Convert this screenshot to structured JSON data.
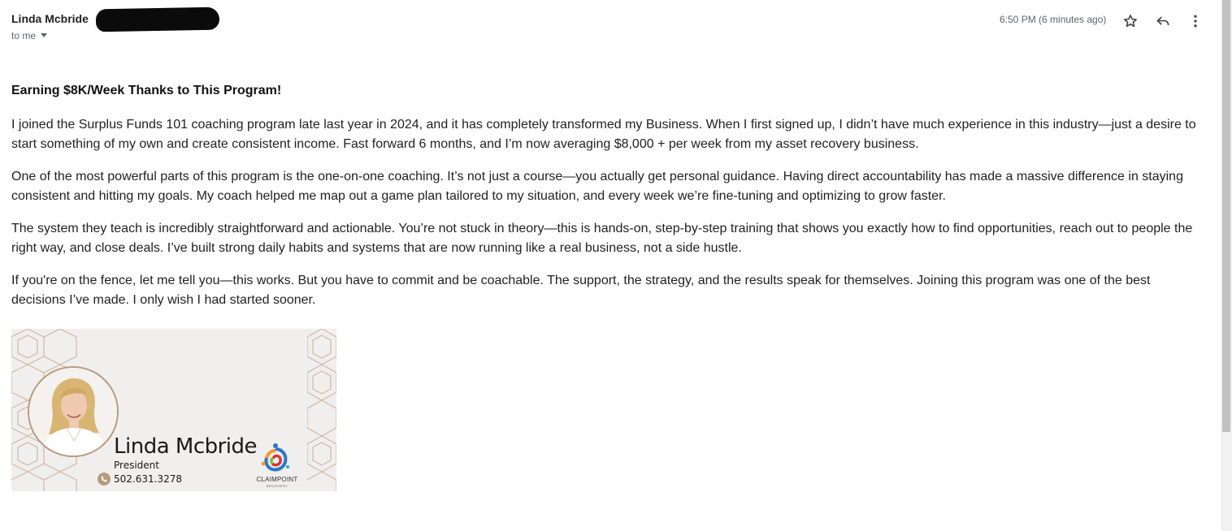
{
  "header": {
    "sender_name": "Linda Mcbride",
    "recipient_label": "to me",
    "timestamp": "6:50 PM (6 minutes ago)",
    "icons": [
      "star-icon",
      "reply-icon",
      "more-vert-icon"
    ]
  },
  "email": {
    "subject": "Earning $8K/Week Thanks to This Program!",
    "paragraphs": [
      "I joined the Surplus Funds 101 coaching program late last year in 2024, and it has completely transformed my Business. When I first signed up, I didn’t have much experience in this industry—just a desire to start something of my own and create consistent income. Fast forward 6 months, and I’m now averaging $8,000 + per week from my asset recovery business.",
      "One of the most powerful parts of this program is the one-on-one coaching. It’s not just a course—you actually get personal guidance. Having direct accountability has made a massive difference in staying consistent and hitting my goals. My coach helped me map out a game plan tailored to my situation, and every week we’re fine-tuning and optimizing to grow faster.",
      "The system they teach is incredibly straightforward and actionable. You’re not stuck in theory—this is hands-on, step-by-step training that shows you exactly how to find opportunities, reach out to people the right way, and close deals. I’ve built strong daily habits and systems that are now running like a real business, not a side hustle.",
      "If you're on the fence, let me tell you—this works. But you have to commit and be coachable. The support, the strategy, and the results speak for themselves. Joining this program was one of the best decisions I’ve made. I only wish I had started sooner."
    ]
  },
  "signature": {
    "name": "Linda Mcbride",
    "title": "President",
    "phone": "502.631.3278",
    "logo_text": "CLAIMPOINT",
    "logo_subtext": "RECOVERY",
    "accent_color": "#b79a80"
  }
}
